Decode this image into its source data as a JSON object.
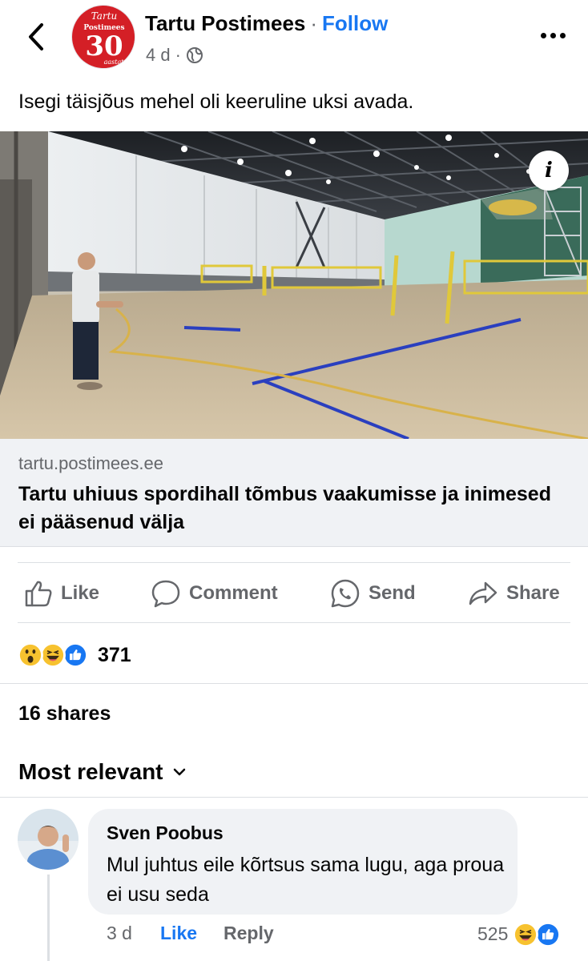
{
  "header": {
    "page_name": "Tartu Postimees",
    "separator": "·",
    "follow_label": "Follow",
    "timestamp": "4 d",
    "meta_dot": "·",
    "avatar_text_top": "Tartu",
    "avatar_text_mid": "Postimees",
    "avatar_text_num": "30",
    "avatar_text_sub": "aastat",
    "icons": {
      "back": "chevron-left-icon",
      "privacy": "globe-icon",
      "more": "more-dots-icon"
    }
  },
  "post": {
    "text": "Isegi täisjõus mehel oli keeruline uksi avada.",
    "info_label": "i"
  },
  "link_preview": {
    "domain": "tartu.postimees.ee",
    "title": "Tartu uhiuus spordihall tõmbus vaakumisse ja inimesed ei pääsenud välja"
  },
  "actions": {
    "like": "Like",
    "comment": "Comment",
    "send": "Send",
    "share": "Share"
  },
  "reactions": {
    "count": "371",
    "types": [
      "wow",
      "haha",
      "like"
    ]
  },
  "shares": "16 shares",
  "comments_sort": "Most relevant",
  "comment": {
    "author": "Sven Poobus",
    "text": "Mul juhtus eile kõrtsus sama lugu, aga proua ei usu seda",
    "time": "3 d",
    "like_label": "Like",
    "reply_label": "Reply",
    "reaction_count": "525",
    "reaction_types": [
      "haha",
      "like"
    ]
  },
  "colors": {
    "accent": "#1877f2",
    "secondary_text": "#65676b",
    "link_bg": "#f0f2f5",
    "divider": "#dcdfe3",
    "brand_red": "#d41f26"
  }
}
